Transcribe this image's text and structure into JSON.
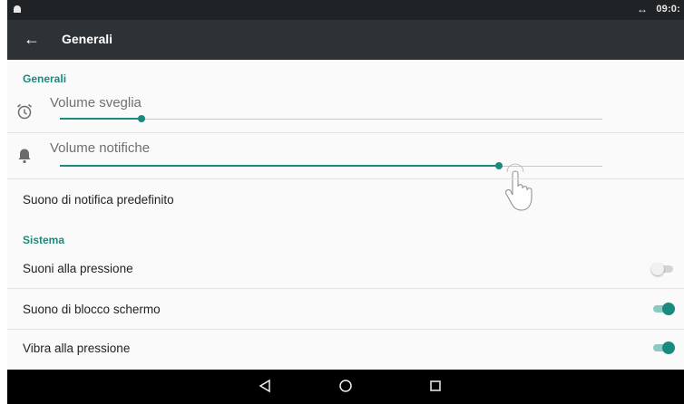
{
  "status_bar": {
    "time": "09:0:",
    "sync_icon": "↔"
  },
  "toolbar": {
    "title": "Generali",
    "back_icon": "arrow-back-icon"
  },
  "sections": {
    "generali": "Generali",
    "sistema": "Sistema"
  },
  "sliders": {
    "alarm": {
      "label": "Volume sveglia",
      "level": 0.15
    },
    "notification": {
      "label": "Volume notifiche",
      "level": 0.81
    }
  },
  "items": {
    "default_notification_sound": "Suono di notifica predefinito",
    "touch_sounds": {
      "label": "Suoni alla pressione",
      "enabled": false
    },
    "screen_lock_sound": {
      "label": "Suono di blocco schermo",
      "enabled": true
    },
    "vibrate_on_touch": {
      "label": "Vibra alla pressione",
      "enabled": true
    }
  },
  "colors": {
    "accent": "#1a8a7e",
    "toolbar": "#2d3236",
    "statusbar": "#1f2326"
  }
}
